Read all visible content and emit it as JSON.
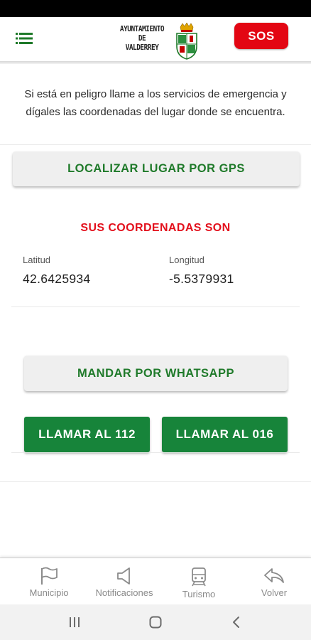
{
  "header": {
    "logo_text": "AYUNTAMIENTO DE VALDERREY",
    "logo_line1": "AYUNTAMIENTO",
    "logo_line2": "DE",
    "logo_line3": "VALDERREY",
    "sos_label": "SOS",
    "menu_icon": "menu-icon",
    "colors": {
      "accent_green": "#1f7a2a",
      "sos_red": "#e30613"
    }
  },
  "main": {
    "intro_text": "Si está en peligro llame a los servicios de emergencia y dígales las coordenadas del lugar donde se encuentra.",
    "locate_button_label": "LOCALIZAR LUGAR POR GPS",
    "coords_title": "SUS COORDENADAS SON",
    "latitude": {
      "label": "Latitud",
      "value": "42.6425934"
    },
    "longitude": {
      "label": "Longitud",
      "value": "-5.5379931"
    },
    "whatsapp_button_label": "MANDAR POR WHATSAPP",
    "call_112_label": "LLAMAR AL 112",
    "call_016_label": "LLAMAR AL 016"
  },
  "bottom_nav": {
    "items": [
      {
        "label": "Municipio",
        "icon": "flag-icon"
      },
      {
        "label": "Notificaciones",
        "icon": "megaphone-icon"
      },
      {
        "label": "Turismo",
        "icon": "train-icon"
      },
      {
        "label": "Volver",
        "icon": "reply-icon"
      }
    ]
  },
  "system_nav": {
    "icons": [
      "recents-icon",
      "home-icon",
      "back-icon"
    ]
  }
}
